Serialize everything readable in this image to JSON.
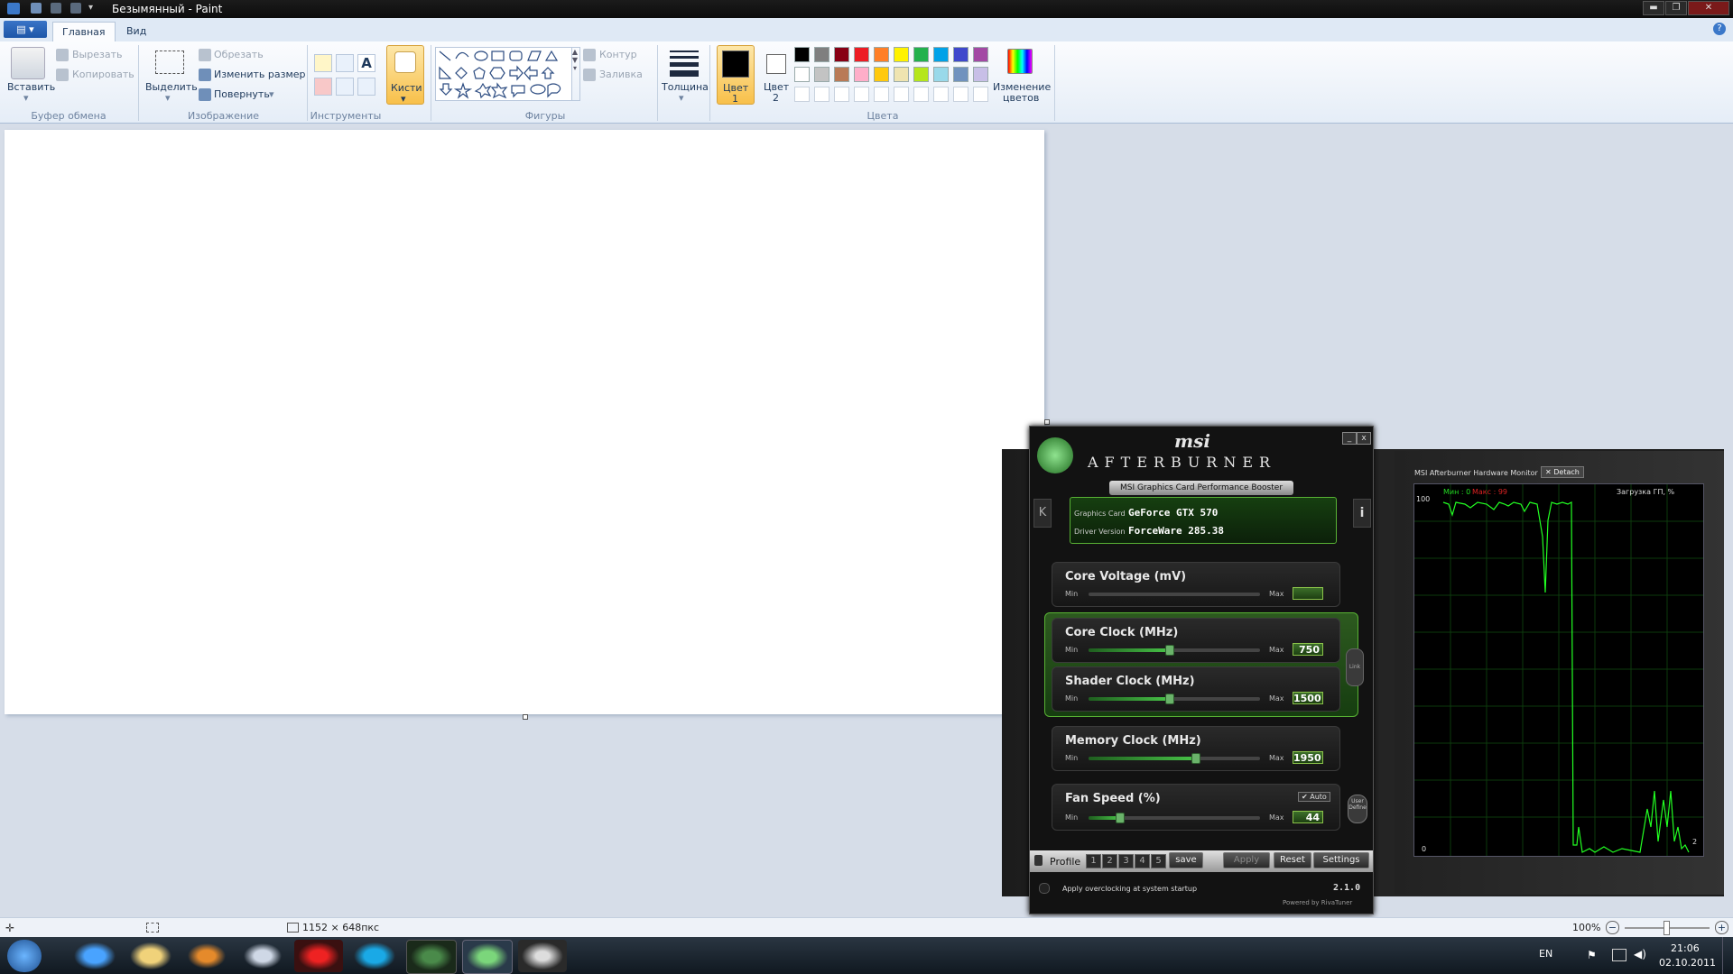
{
  "window": {
    "title": "Безымянный - Paint",
    "min": "▬",
    "max": "❐",
    "close": "✕"
  },
  "ribbon": {
    "file_menu": "▤ ▾",
    "tabs": [
      {
        "label": "Главная",
        "active": true
      },
      {
        "label": "Вид",
        "active": false
      }
    ],
    "clipboard": {
      "paste": "Вставить",
      "cut": "Вырезать",
      "copy": "Копировать",
      "group": "Буфер обмена"
    },
    "image": {
      "select": "Выделить",
      "crop": "Обрезать",
      "resize": "Изменить размер",
      "rotate": "Повернуть",
      "group": "Изображение"
    },
    "tools": {
      "group": "Инструменты",
      "text_tool": "A"
    },
    "brushes": {
      "label": "Кисти"
    },
    "shapes": {
      "outline": "Контур",
      "fill": "Заливка",
      "group": "Фигуры"
    },
    "size": {
      "label": "Толщина"
    },
    "colors": {
      "color1_label": "Цвет",
      "color1_num": "1",
      "color2_label": "Цвет",
      "color2_num": "2",
      "edit_label1": "Изменение",
      "edit_label2": "цветов",
      "group": "Цвета",
      "color1": "#000000",
      "color2": "#ffffff",
      "palette_row1": [
        "#000000",
        "#7f7f7f",
        "#880015",
        "#ed1c24",
        "#ff7f27",
        "#fff200",
        "#22b14c",
        "#00a2e8",
        "#3f48cc",
        "#a349a4"
      ],
      "palette_row2": [
        "#ffffff",
        "#c3c3c3",
        "#b97a57",
        "#ffaec9",
        "#ffc90e",
        "#efe4b0",
        "#b5e61d",
        "#99d9ea",
        "#7092be",
        "#c8bfe7"
      ]
    }
  },
  "statusbar": {
    "dimensions": "1152 × 648пкс",
    "zoom": "100%"
  },
  "taskbar": {
    "lang": "EN",
    "time": "21:06",
    "date": "02.10.2011"
  },
  "afterburner": {
    "brand": "msi",
    "product": "AFTERBURNER",
    "subtitle": "MSI Graphics Card Performance Booster",
    "graphics_card_label": "Graphics Card",
    "graphics_card": "GeForce GTX 570",
    "driver_label": "Driver Version",
    "driver": "ForceWare 285.38",
    "min_label": "Min",
    "max_label": "Max",
    "sliders": [
      {
        "title": "Core Voltage (mV)",
        "value": "",
        "fraction": 0.0
      },
      {
        "title": "Core Clock (MHz)",
        "value": "750",
        "fraction": 0.47
      },
      {
        "title": "Shader Clock (MHz)",
        "value": "1500",
        "fraction": 0.47
      },
      {
        "title": "Memory Clock (MHz)",
        "value": "1950",
        "fraction": 0.62
      },
      {
        "title": "Fan Speed (%)",
        "value": "44",
        "fraction": 0.18
      }
    ],
    "auto_label": "Auto",
    "link_label": "Link",
    "user_define": "User Define",
    "profile_label": "Profile",
    "profiles": [
      "1",
      "2",
      "3",
      "4",
      "5"
    ],
    "save": "save",
    "apply": "Apply",
    "reset": "Reset",
    "settings": "Settings",
    "startup_text": "Apply overclocking at system startup",
    "version": "2.1.0",
    "powered": "Powered by RivaTuner",
    "left_nav": "K",
    "info": "i"
  },
  "monitor": {
    "title": "MSI Afterburner Hardware Monitor",
    "detach": "Detach",
    "min_text": "Мин : 0",
    "max_text": "Макс : 99",
    "graph_label": "Загрузка ГП, %",
    "y_top": "100",
    "y_bottom": "0",
    "current": "2"
  }
}
